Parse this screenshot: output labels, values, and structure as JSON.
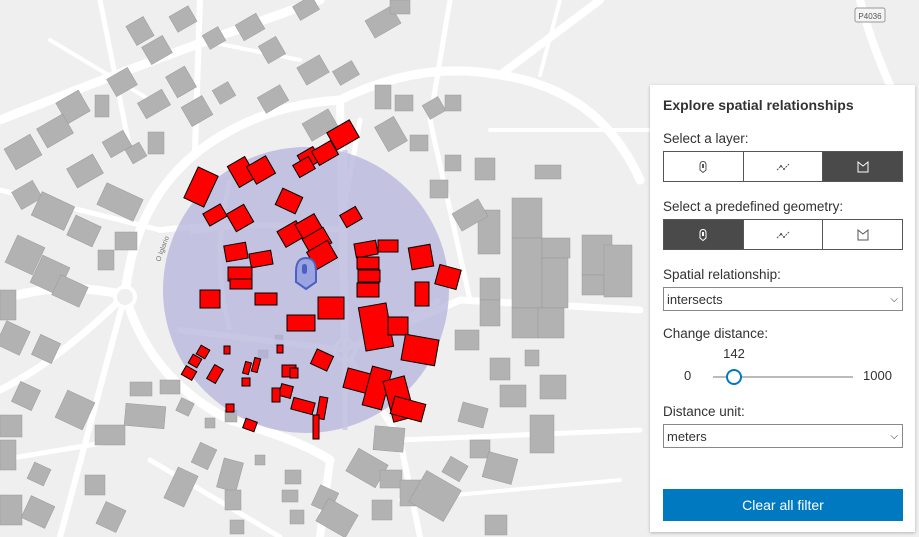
{
  "map": {
    "road_labels": [
      "P4036",
      "O Iglario"
    ],
    "colors": {
      "background": "#efefef",
      "road": "#ffffff",
      "building": "#b2b2b2",
      "selected": "#ff0000",
      "buffer": "#b4b4dc",
      "marker": "#4b5fc4"
    }
  },
  "panel": {
    "title": "Explore spatial relationships",
    "layer_label": "Select a layer:",
    "layer_buttons": [
      {
        "icon": "point-icon",
        "active": false
      },
      {
        "icon": "polyline-icon",
        "active": false
      },
      {
        "icon": "polygon-icon",
        "active": true
      }
    ],
    "geometry_label": "Select a predefined geometry:",
    "geometry_buttons": [
      {
        "icon": "point-icon",
        "active": true
      },
      {
        "icon": "polyline-icon",
        "active": false
      },
      {
        "icon": "polygon-icon",
        "active": false
      }
    ],
    "relationship_label": "Spatial relationship:",
    "relationship_value": "intersects",
    "distance_label": "Change distance:",
    "distance_value": "142",
    "distance_min": "0",
    "distance_max": "1000",
    "unit_label": "Distance unit:",
    "unit_value": "meters",
    "clear_button": "Clear all filter",
    "accent": "#0079c1"
  }
}
